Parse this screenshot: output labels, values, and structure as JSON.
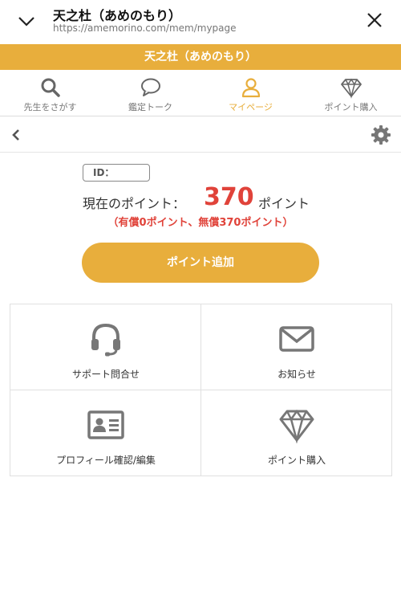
{
  "browser": {
    "title": "天之杜（あめのもり）",
    "url": "https://amemorino.com/mem/mypage"
  },
  "header": {
    "brand": "天之杜（あめのもり）"
  },
  "tabs": [
    {
      "label": "先生をさがす",
      "icon": "search-icon"
    },
    {
      "label": "鑑定トーク",
      "icon": "chat-bubble-icon"
    },
    {
      "label": "マイページ",
      "icon": "user-icon",
      "active": true
    },
    {
      "label": "ポイント購入",
      "icon": "diamond-icon"
    }
  ],
  "account": {
    "id_label": "ID：",
    "points_label": "現在のポイント：",
    "points_value": "370",
    "points_unit": "ポイント",
    "breakdown": "（有償0ポイント、無償370ポイント）",
    "add_button": "ポイント追加"
  },
  "menu": [
    {
      "label": "サポート問合せ",
      "icon": "headset-icon"
    },
    {
      "label": "お知らせ",
      "icon": "envelope-icon"
    },
    {
      "label": "プロフィール確認/編集",
      "icon": "id-card-icon"
    },
    {
      "label": "ポイント購入",
      "icon": "diamond-icon"
    }
  ],
  "colors": {
    "accent": "#e8ae3c",
    "points_red": "#e0433a",
    "icon_gray": "#777777"
  }
}
